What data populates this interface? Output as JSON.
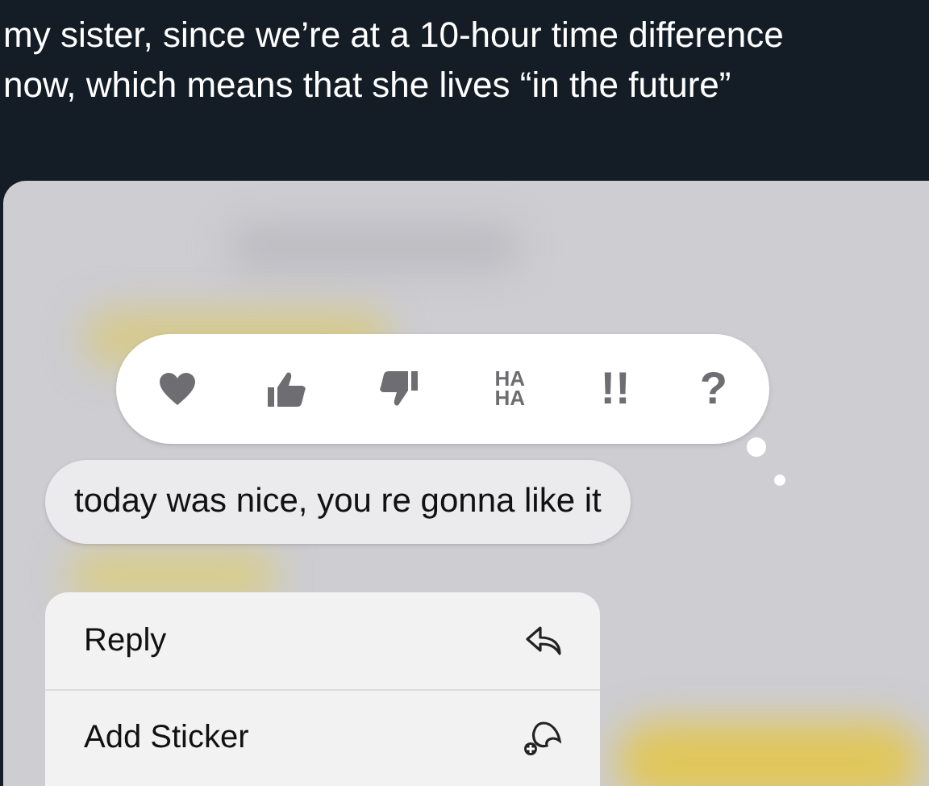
{
  "post_text": [
    "my sister, since we’re at a 10-hour time difference",
    "now, which means that she lives “in the future”"
  ],
  "reactions": [
    {
      "kind": "heart"
    },
    {
      "kind": "thumbs_up"
    },
    {
      "kind": "thumbs_down"
    },
    {
      "kind": "text",
      "label": "HA HA"
    },
    {
      "kind": "text",
      "label": "!!"
    },
    {
      "kind": "text",
      "label": "?"
    }
  ],
  "message": "today was nice, you re gonna like it",
  "menu": [
    {
      "label": "Reply",
      "kind": "reply"
    },
    {
      "label": "Add Sticker",
      "kind": "sticker"
    }
  ]
}
